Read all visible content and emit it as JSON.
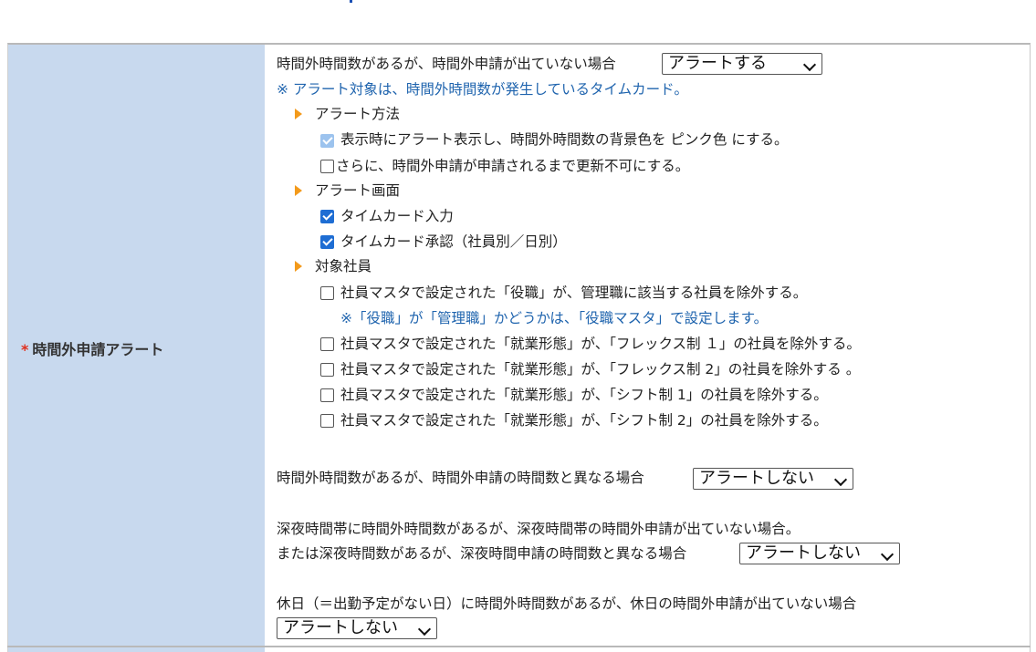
{
  "row": {
    "required_mark": "*",
    "label": "時間外申請アラート"
  },
  "setting1": {
    "text": "時間外時間数があるが、時間外申請が出ていない場合",
    "select_value": "アラートする",
    "note": "※ アラート対象は、時間外時間数が発生しているタイムカード。"
  },
  "method": {
    "title": "アラート方法",
    "options": [
      {
        "label": "表示時にアラート表示し、時間外時間数の背景色を ピンク色 にする。",
        "checked": true,
        "disabled": true
      },
      {
        "label": "さらに、時間外申請が申請されるまで更新不可にする。",
        "checked": false,
        "disabled": false
      }
    ]
  },
  "screen": {
    "title": "アラート画面",
    "options": [
      {
        "label": "タイムカード入力",
        "checked": true
      },
      {
        "label": "タイムカード承認（社員別／日別）",
        "checked": true
      }
    ]
  },
  "target": {
    "title": "対象社員",
    "options": [
      {
        "label": "社員マスタで設定された「役職」が、管理職に該当する社員を除外する。",
        "checked": false
      },
      {
        "label": "社員マスタで設定された「就業形態」が、「フレックス制 １」の社員を除外する。",
        "checked": false
      },
      {
        "label": "社員マスタで設定された「就業形態」が、「フレックス制 2」の社員を除外する 。",
        "checked": false
      },
      {
        "label": "社員マスタで設定された「就業形態」が、「シフト制 1」の社員を除外する。",
        "checked": false
      },
      {
        "label": "社員マスタで設定された「就業形態」が、「シフト制 2」の社員を除外する。",
        "checked": false
      }
    ],
    "note": "※「役職」が「管理職」かどうかは、「役職マスタ」で設定します。"
  },
  "setting2": {
    "text": "時間外時間数があるが、時間外申請の時間数と異なる場合",
    "select_value": "アラートしない"
  },
  "setting3": {
    "text_line1": "深夜時間帯に時間外時間数があるが、深夜時間帯の時間外申請が出ていない場合。",
    "text_line2": "または深夜時間数があるが、深夜時間申請の時間数と異なる場合",
    "select_value": "アラートしない"
  },
  "setting4": {
    "text": "休日（＝出勤予定がない日）に時間外時間数があるが、休日の時間外申請が出ていない場合",
    "select_value": "アラートしない"
  },
  "colors": {
    "label_bg": "#c8d9ee",
    "note_blue": "#1f64ae",
    "required_red": "#e0301e",
    "bullet_orange": "#f39a1b",
    "checkbox_blue": "#1e6dd3"
  }
}
